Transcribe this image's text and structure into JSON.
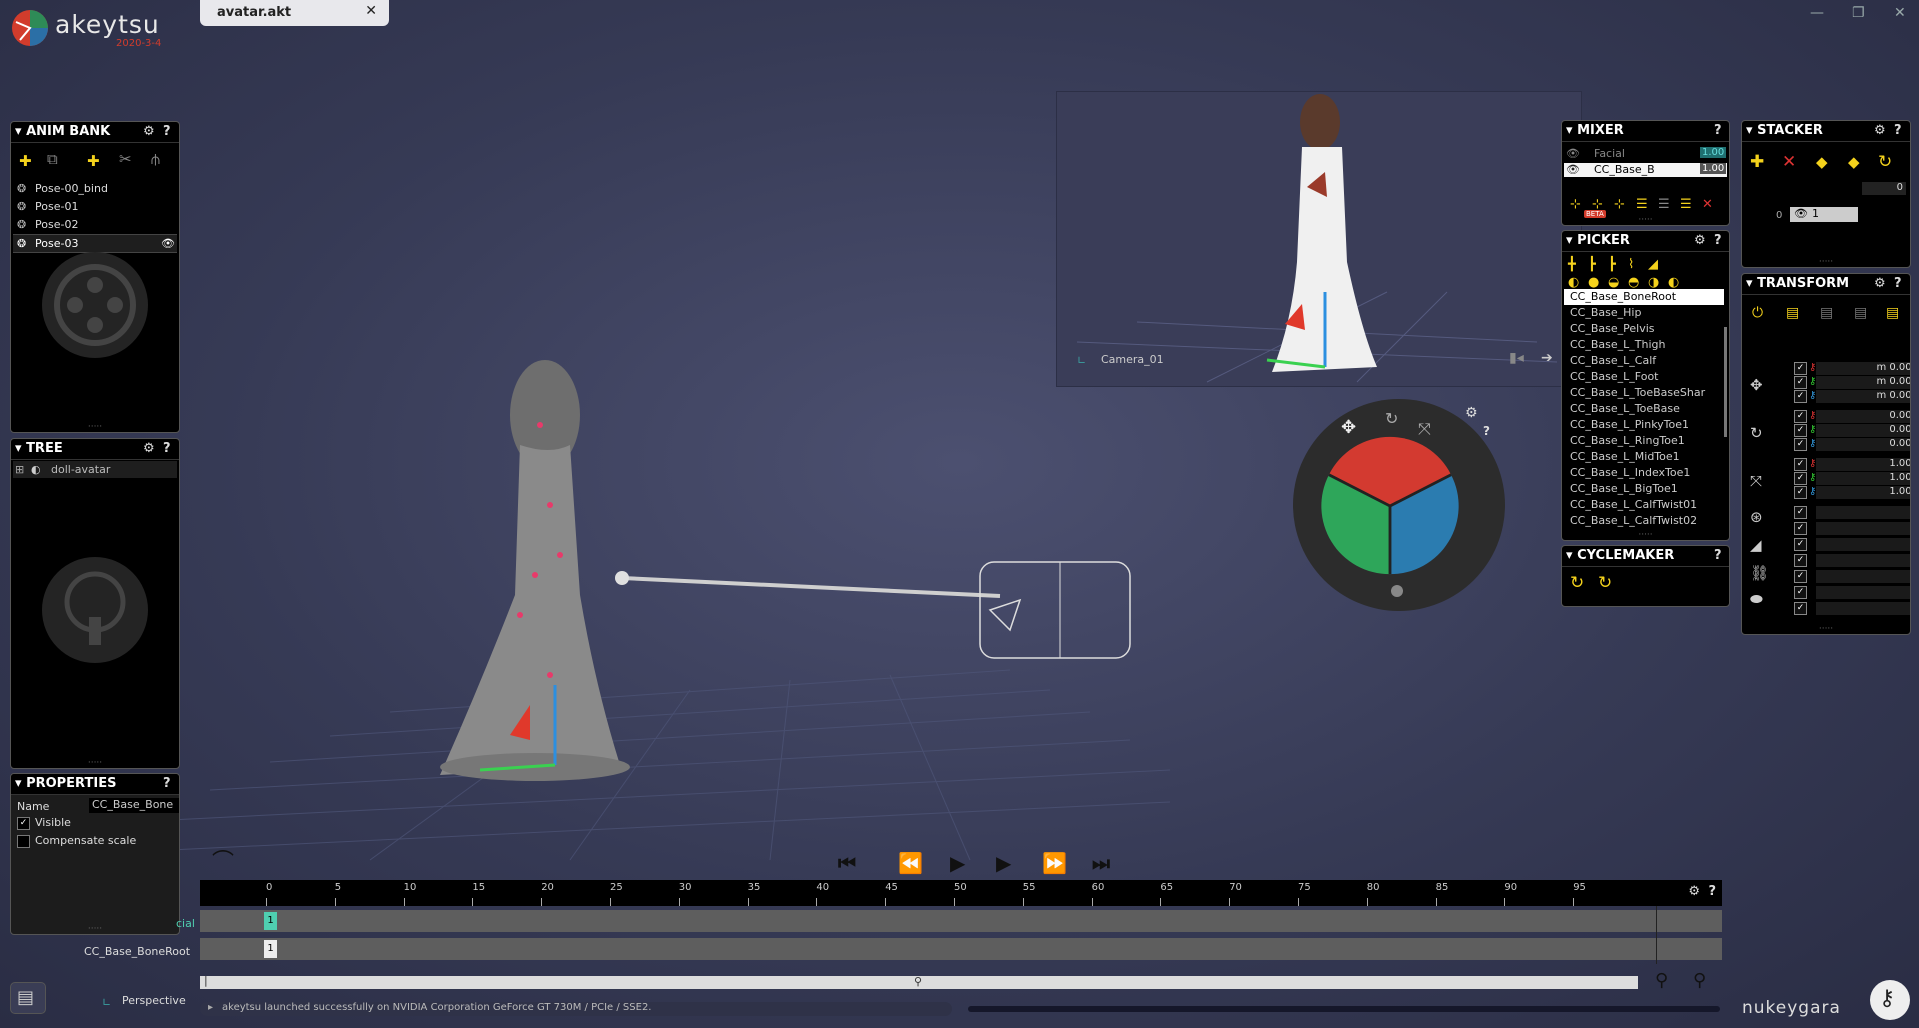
{
  "app": {
    "name": "akeytsu",
    "version": "2020-3-4",
    "brand": "nukeygara"
  },
  "tab": {
    "title": "avatar.akt",
    "close": "✕"
  },
  "window_controls": {
    "minimize": "—",
    "maximize": "❐",
    "close": "✕"
  },
  "anim_bank": {
    "title": "ANIM BANK",
    "items": [
      {
        "label": "Pose-00_bind",
        "selected": false
      },
      {
        "label": "Pose-01",
        "selected": false
      },
      {
        "label": "Pose-02",
        "selected": false
      },
      {
        "label": "Pose-03",
        "selected": true
      }
    ]
  },
  "tree": {
    "title": "TREE",
    "items": [
      {
        "label": "doll-avatar"
      }
    ]
  },
  "properties": {
    "title": "PROPERTIES",
    "name_label": "Name",
    "name_value": "CC_Base_Bone",
    "visible_label": "Visible",
    "visible_checked": true,
    "compensate_label": "Compensate scale",
    "compensate_checked": false
  },
  "camera_view": {
    "label": "Camera_01"
  },
  "viewport": {
    "label": "Perspective"
  },
  "mixer": {
    "title": "MIXER",
    "beta": "BETA",
    "layers": [
      {
        "label": "Facial",
        "weight": "1.00"
      },
      {
        "label": "CC_Base_B",
        "weight": "1.00"
      }
    ]
  },
  "picker": {
    "title": "PICKER",
    "items": [
      "CC_Base_BoneRoot",
      "CC_Base_Hip",
      "CC_Base_Pelvis",
      "CC_Base_L_Thigh",
      "CC_Base_L_Calf",
      "CC_Base_L_Foot",
      "CC_Base_L_ToeBaseShar",
      "CC_Base_L_ToeBase",
      "CC_Base_L_PinkyToe1",
      "CC_Base_L_RingToe1",
      "CC_Base_L_MidToe1",
      "CC_Base_L_IndexToe1",
      "CC_Base_L_BigToe1",
      "CC_Base_L_CalfTwist01",
      "CC_Base_L_CalfTwist02"
    ],
    "selected_index": 0
  },
  "cyclemaker": {
    "title": "CYCLEMAKER"
  },
  "stacker": {
    "title": "STACKER",
    "counter": "0",
    "layer_index": "0",
    "layer_value": "1"
  },
  "transform": {
    "title": "TRANSFORM",
    "rows": [
      {
        "value": "m 0.000",
        "color": "#d33"
      },
      {
        "value": "m 0.000",
        "color": "#3c3"
      },
      {
        "value": "m 0.000",
        "color": "#39d"
      },
      {
        "value": "0.000",
        "color": "#d33"
      },
      {
        "value": "0.000",
        "color": "#3c3"
      },
      {
        "value": "0.000",
        "color": "#39d"
      },
      {
        "value": "1.000",
        "color": "#d33"
      },
      {
        "value": "1.000",
        "color": "#3c3"
      },
      {
        "value": "1.000",
        "color": "#39d"
      },
      {
        "value": "",
        "color": ""
      },
      {
        "value": "",
        "color": ""
      },
      {
        "value": "",
        "color": ""
      },
      {
        "value": "",
        "color": ""
      },
      {
        "value": "",
        "color": ""
      },
      {
        "value": "",
        "color": ""
      },
      {
        "value": "",
        "color": ""
      }
    ]
  },
  "timeline": {
    "ticks": [
      "0",
      "5",
      "10",
      "15",
      "20",
      "25",
      "30",
      "35",
      "40",
      "45",
      "50",
      "55",
      "60",
      "65",
      "70",
      "75",
      "80",
      "85",
      "90",
      "95"
    ],
    "tracks": [
      {
        "label": "cial",
        "key": "1"
      },
      {
        "label": "CC_Base_BoneRoot",
        "key": "1"
      }
    ]
  },
  "status": {
    "message": "akeytsu launched successfully on NVIDIA Corporation GeForce GT 730M / PCIe / SSE2."
  },
  "colors": {
    "accent_yellow": "#f4d21c",
    "brand_red": "#d23c2c",
    "x_axis": "#d33",
    "y_axis": "#3c3",
    "z_axis": "#39d"
  }
}
